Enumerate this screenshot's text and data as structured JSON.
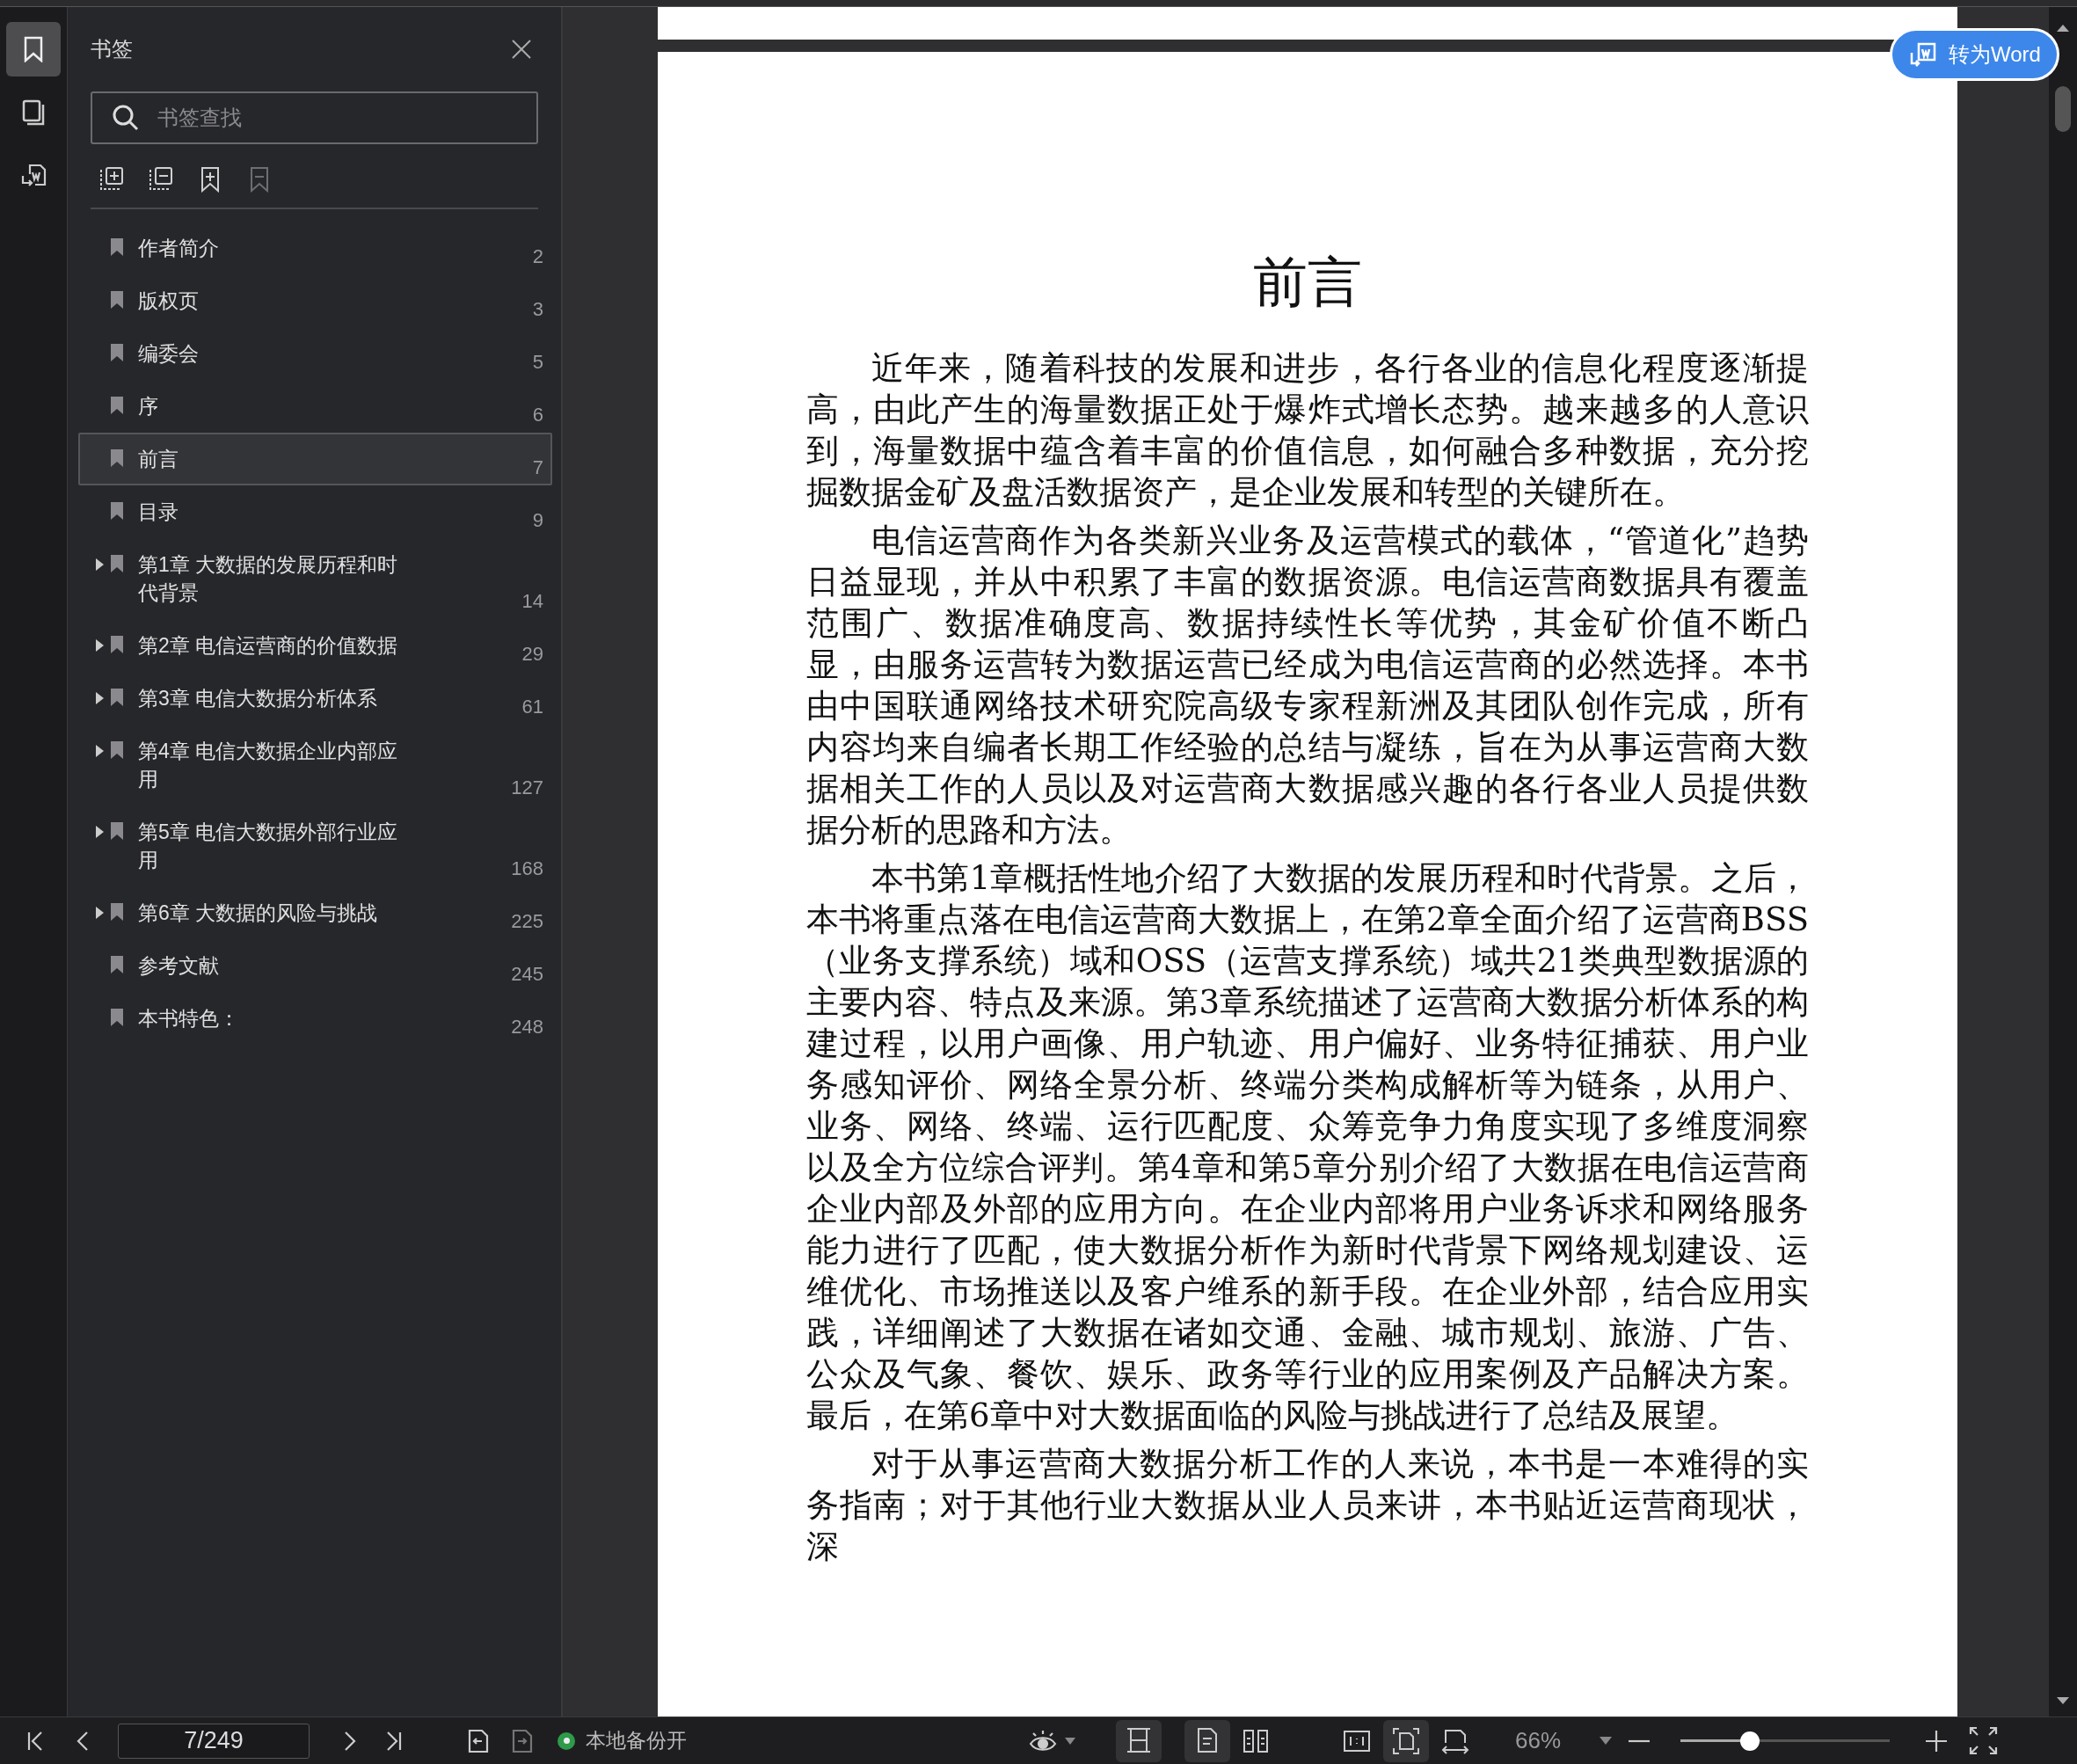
{
  "rail": [
    {
      "kind": "bookmarks",
      "selected": true
    },
    {
      "kind": "thumbnails",
      "selected": false
    },
    {
      "kind": "convert",
      "selected": false
    }
  ],
  "sidebar": {
    "title": "书签",
    "search": {
      "placeholder": "书签查找"
    },
    "tools": [
      {
        "kind": "expand-all",
        "disabled": false
      },
      {
        "kind": "collapse-all",
        "disabled": false
      },
      {
        "kind": "add-bookmark",
        "disabled": false
      },
      {
        "kind": "remove-bookmark",
        "disabled": true
      }
    ],
    "bookmarks": [
      {
        "label": "作者简介",
        "page": "2",
        "selected": false,
        "expandable": false
      },
      {
        "label": "版权页",
        "page": "3",
        "selected": false,
        "expandable": false
      },
      {
        "label": "编委会",
        "page": "5",
        "selected": false,
        "expandable": false
      },
      {
        "label": "序",
        "page": "6",
        "selected": false,
        "expandable": false
      },
      {
        "label": "前言",
        "page": "7",
        "selected": true,
        "expandable": false
      },
      {
        "label": "目录",
        "page": "9",
        "selected": false,
        "expandable": false
      },
      {
        "label": "第1章  大数据的发展历程和时代背景",
        "page": "14",
        "selected": false,
        "expandable": true
      },
      {
        "label": "第2章  电信运营商的价值数据",
        "page": "29",
        "selected": false,
        "expandable": true
      },
      {
        "label": "第3章  电信大数据分析体系",
        "page": "61",
        "selected": false,
        "expandable": true
      },
      {
        "label": "第4章  电信大数据企业内部应用",
        "page": "127",
        "selected": false,
        "expandable": true
      },
      {
        "label": "第5章  电信大数据外部行业应用",
        "page": "168",
        "selected": false,
        "expandable": true
      },
      {
        "label": "第6章  大数据的风险与挑战",
        "page": "225",
        "selected": false,
        "expandable": true
      },
      {
        "label": "参考文献",
        "page": "245",
        "selected": false,
        "expandable": false
      },
      {
        "label": "本书特色：",
        "page": "248",
        "selected": false,
        "expandable": false
      }
    ]
  },
  "document": {
    "title": "前言",
    "paragraphs": [
      "近年来，随着科技的发展和进步，各行各业的信息化程度逐渐提高，由此产生的海量数据正处于爆炸式增长态势。越来越多的人意识到，海量数据中蕴含着丰富的价值信息，如何融合多种数据，充分挖掘数据金矿及盘活数据资产，是企业发展和转型的关键所在。",
      "电信运营商作为各类新兴业务及运营模式的载体，“管道化”趋势日益显现，并从中积累了丰富的数据资源。电信运营商数据具有覆盖范围广、数据准确度高、数据持续性长等优势，其金矿价值不断凸显，由服务运营转为数据运营已经成为电信运营商的必然选择。本书由中国联通网络技术研究院高级专家程新洲及其团队创作完成，所有内容均来自编者长期工作经验的总结与凝练，旨在为从事运营商大数据相关工作的人员以及对运营商大数据感兴趣的各行各业人员提供数据分析的思路和方法。",
      "本书第1章概括性地介绍了大数据的发展历程和时代背景。之后，本书将重点落在电信运营商大数据上，在第2章全面介绍了运营商BSS（业务支撑系统）域和OSS（运营支撑系统）域共21类典型数据源的主要内容、特点及来源。第3章系统描述了运营商大数据分析体系的构建过程，以用户画像、用户轨迹、用户偏好、业务特征捕获、用户业务感知评价、网络全景分析、终端分类构成解析等为链条，从用户、业务、网络、终端、运行匹配度、众筹竞争力角度实现了多维度洞察以及全方位综合评判。第4章和第5章分别介绍了大数据在电信运营商企业内部及外部的应用方向。在企业内部将用户业务诉求和网络服务能力进行了匹配，使大数据分析作为新时代背景下网络规划建设、运维优化、市场推送以及客户维系的新手段。在企业外部，结合应用实践，详细阐述了大数据在诸如交通、金融、城市规划、旅游、广告、公众及气象、餐饮、娱乐、政务等行业的应用案例及产品解决方案。最后，在第6章中对大数据面临的风险与挑战进行了总结及展望。",
      "对于从事运营商大数据分析工作的人来说，本书是一本难得的实务指南；对于其他行业大数据从业人员来讲，本书贴近运营商现状，深"
    ]
  },
  "convert_button": {
    "label": "转为Word"
  },
  "status_bar": {
    "page_field": {
      "value": "7/249"
    },
    "backup": {
      "label": "本地备份开",
      "on": true
    },
    "view_modes": [
      {
        "kind": "continuous",
        "selected": true
      },
      {
        "kind": "single-page",
        "selected": true
      },
      {
        "kind": "two-page",
        "selected": false
      },
      {
        "kind": "actual-size",
        "selected": false
      },
      {
        "kind": "fit-page",
        "selected": true
      },
      {
        "kind": "fit-width",
        "selected": false
      }
    ],
    "zoom": {
      "value": "66%",
      "level": 0.33
    }
  }
}
